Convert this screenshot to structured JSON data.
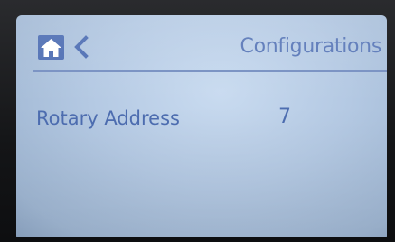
{
  "header": {
    "home_icon": "home-icon",
    "back_icon": "chevron-left-icon",
    "title": "Configurations"
  },
  "settings": {
    "rows": [
      {
        "label": "Rotary Address",
        "value": "7"
      }
    ]
  },
  "colors": {
    "accent": "#4f6fb4",
    "screen_background": "#bcd0e8",
    "text": "#4d6db0"
  }
}
